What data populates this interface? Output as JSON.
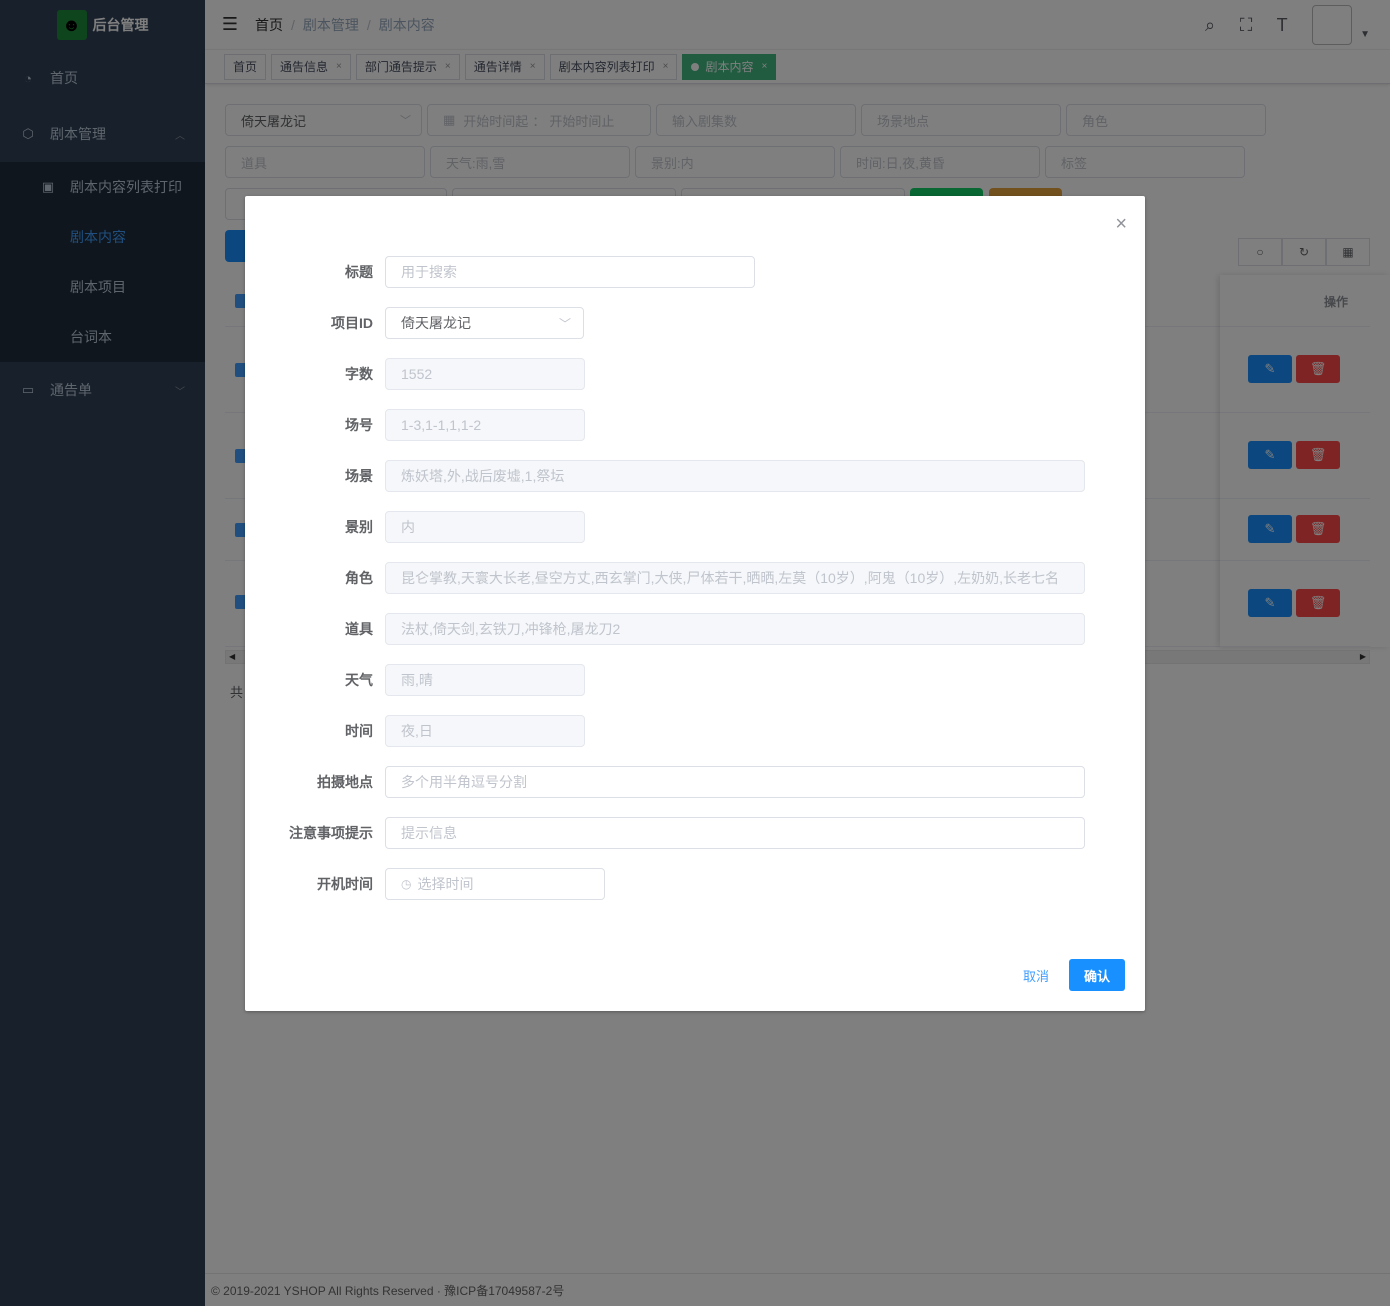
{
  "app": {
    "title": "后台管理",
    "logo_icon": "spy-icon"
  },
  "sidebar": {
    "items": [
      {
        "label": "首页"
      },
      {
        "label": "剧本管理"
      },
      {
        "label": "通告单"
      }
    ],
    "sub_items": [
      {
        "label": "剧本内容列表打印"
      },
      {
        "label": "剧本内容"
      },
      {
        "label": "剧本项目"
      },
      {
        "label": "台词本"
      }
    ]
  },
  "breadcrumb": [
    "首页",
    "剧本管理",
    "剧本内容"
  ],
  "tabs": [
    {
      "label": "首页"
    },
    {
      "label": "通告信息"
    },
    {
      "label": "部门通告提示"
    },
    {
      "label": "通告详情"
    },
    {
      "label": "剧本内容列表打印"
    },
    {
      "label": "剧本内容"
    }
  ],
  "filters": {
    "project": "倚天屠龙记",
    "date_start": "开始时间起",
    "date_sep": "：",
    "date_end": "开始时间止",
    "episode": "输入剧集数",
    "location": "场景地点",
    "role": "角色",
    "prop": "道具",
    "weather": "天气:雨,雪",
    "scene_type": "景别:内",
    "time": "时间:日,夜,黄昏",
    "tag": "标签"
  },
  "table": {
    "op_header": "操作",
    "total_prefix": "共"
  },
  "footer": {
    "text": "© 2019-2021 YSHOP All Rights Reserved · 豫ICP备17049587-2号"
  },
  "dialog": {
    "fields": {
      "title_label": "标题",
      "title_placeholder": "用于搜索",
      "project_label": "项目ID",
      "project_value": "倚天屠龙记",
      "words_label": "字数",
      "words_value": "1552",
      "scene_no_label": "场号",
      "scene_no_value": "1-3,1-1,1,1-2",
      "scene_label": "场景",
      "scene_value": "炼妖塔,外,战后废墟,1,祭坛",
      "scene_type_label": "景别",
      "scene_type_value": "内",
      "role_label": "角色",
      "role_value": "昆仑掌教,天寰大长老,昼空方丈,西玄掌门,大侠,尸体若干,晒晒,左莫（10岁）,阿鬼（10岁）,左奶奶,长老七名",
      "prop_label": "道具",
      "prop_value": "法杖,倚天剑,玄铁刀,冲锋枪,屠龙刀2",
      "weather_label": "天气",
      "weather_value": "雨,晴",
      "time_label": "时间",
      "time_value": "夜,日",
      "shoot_location_label": "拍摄地点",
      "shoot_location_placeholder": "多个用半角逗号分割",
      "notes_label": "注意事项提示",
      "notes_placeholder": "提示信息",
      "start_time_label": "开机时间",
      "start_time_placeholder": "选择时间"
    },
    "cancel": "取消",
    "confirm": "确认"
  },
  "colors": {
    "primary": "#1890ff",
    "sidebar_bg": "#304156",
    "tag_active": "#42b983",
    "danger": "#ff4949"
  }
}
